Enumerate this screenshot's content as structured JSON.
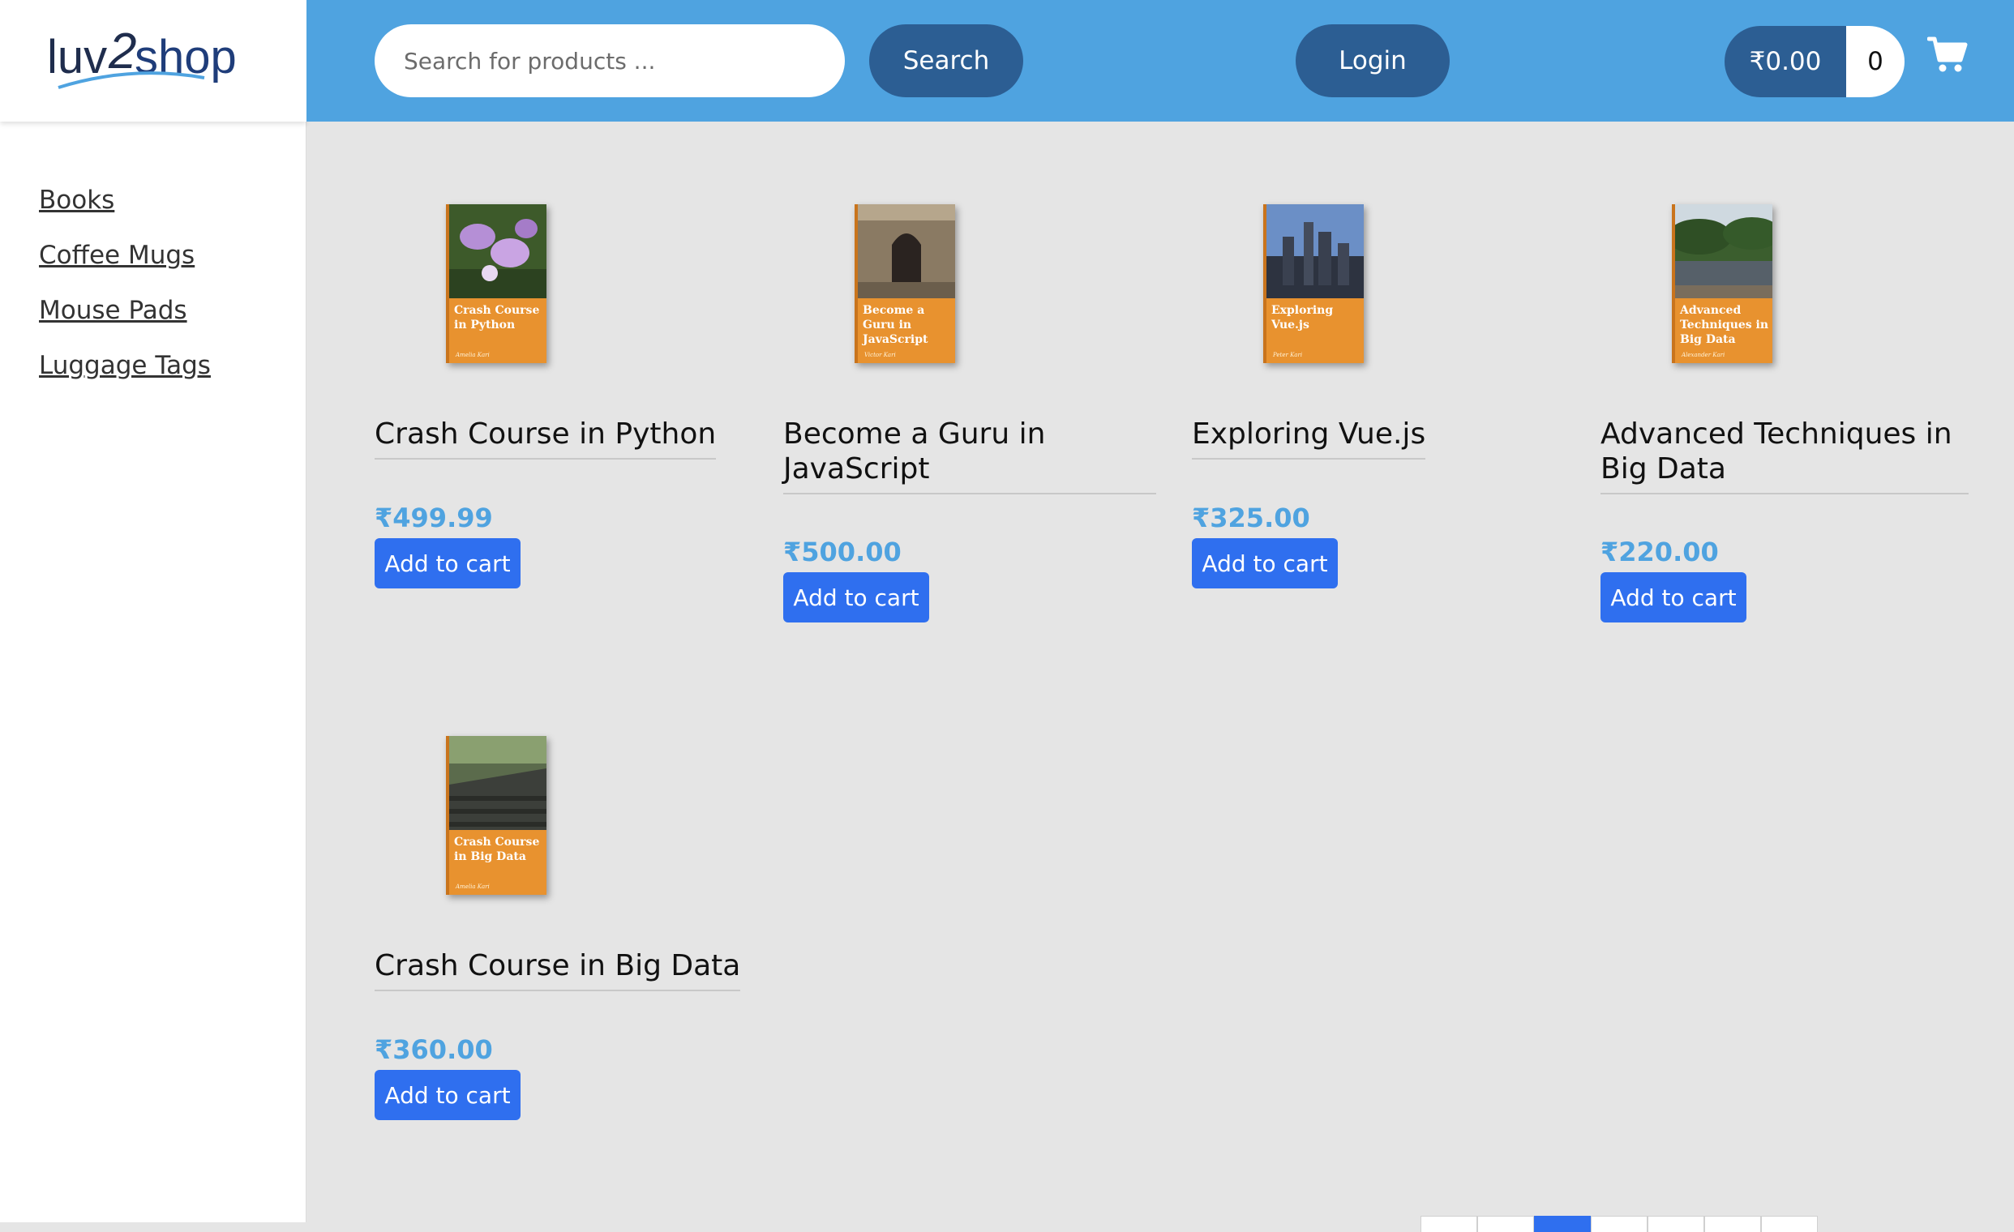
{
  "brand": {
    "logo_text_a": "luv",
    "logo_text_b": "2",
    "logo_text_c": "shop",
    "colors": {
      "header": "#4fa3e0",
      "dark_button": "#2c5e93",
      "primary": "#2f6fef",
      "price": "#4fa3e0"
    }
  },
  "sidebar": {
    "items": [
      {
        "label": "Books"
      },
      {
        "label": "Coffee Mugs"
      },
      {
        "label": "Mouse Pads"
      },
      {
        "label": "Luggage Tags"
      }
    ]
  },
  "header": {
    "search_placeholder": "Search for products ...",
    "search_label": "Search",
    "login_label": "Login",
    "cart_total": "₹0.00",
    "cart_quantity": "0",
    "cart_icon": "shopping-cart-icon"
  },
  "products": [
    {
      "name": "Crash Course in Python",
      "price": "₹499.99",
      "cover_title": "Crash Course in Python",
      "cover_author": "Amelia Kari",
      "button": "Add to cart"
    },
    {
      "name": "Become a Guru in JavaScript",
      "price": "₹500.00",
      "cover_title": "Become a Guru in JavaScript",
      "cover_author": "Victor Kari",
      "button": "Add to cart"
    },
    {
      "name": "Exploring Vue.js",
      "price": "₹325.00",
      "cover_title": "Exploring Vue.js",
      "cover_author": "Peter Kari",
      "button": "Add to cart"
    },
    {
      "name": "Advanced Techniques in Big Data",
      "price": "₹220.00",
      "cover_title": "Advanced Techniques in Big Data",
      "cover_author": "Alexander Kari",
      "button": "Add to cart"
    },
    {
      "name": "Crash Course in Big Data",
      "price": "₹360.00",
      "cover_title": "Crash Course in Big Data",
      "cover_author": "Amelia Kari",
      "button": "Add to cart"
    }
  ]
}
